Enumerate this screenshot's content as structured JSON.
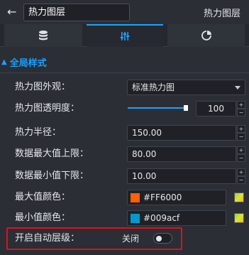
{
  "header": {
    "back_icon": "arrow-left-icon",
    "title_value": "热力图层",
    "right_title": "热力图层"
  },
  "tabs": [
    {
      "icon": "database-icon",
      "active": false
    },
    {
      "icon": "sliders-icon",
      "active": true
    },
    {
      "icon": "pie-chart-icon",
      "active": false
    }
  ],
  "section": {
    "title": "全局样式",
    "accent_color": "#19a2ff"
  },
  "fields": {
    "appearance": {
      "label": "热力图外观：",
      "value": "标准热力图"
    },
    "opacity": {
      "label": "热力图透明度：",
      "value": "100",
      "fill_percent": 100
    },
    "radius": {
      "label": "热力半径：",
      "value": "150.00"
    },
    "max_limit": {
      "label": "数据最大值上限：",
      "value": "80.00"
    },
    "min_limit": {
      "label": "数据最小值下限：",
      "value": "10.00"
    },
    "max_color": {
      "label": "最大值颜色：",
      "value": "#FF6000",
      "swatch": "#FF6000"
    },
    "min_color": {
      "label": "最小值颜色：",
      "value": "#009acf",
      "swatch": "#009acf"
    },
    "auto_level": {
      "label": "开启自动层级：",
      "state_text": "关闭",
      "enabled": false
    }
  }
}
